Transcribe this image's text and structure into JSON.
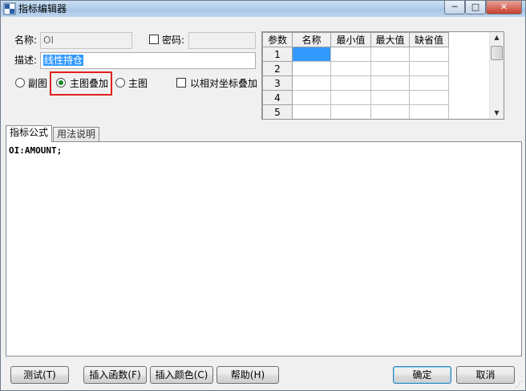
{
  "window": {
    "title": "指标编辑器",
    "controls": {
      "minimize": "─",
      "maximize": "□",
      "close": "✕"
    }
  },
  "form": {
    "name_label": "名称:",
    "name_value": "OI",
    "password_label": "密码:",
    "password_checked": false,
    "password_value": "",
    "desc_label": "描述:",
    "desc_value": "线性持仓",
    "radios": [
      {
        "label": "副图",
        "checked": false
      },
      {
        "label": "主图叠加",
        "checked": true
      },
      {
        "label": "主图",
        "checked": false
      }
    ],
    "relative_coord_label": "以相对坐标叠加",
    "relative_coord_checked": false
  },
  "params_grid": {
    "headers": [
      "参数",
      "名称",
      "最小值",
      "最大值",
      "缺省值"
    ],
    "rows": [
      "1",
      "2",
      "3",
      "4",
      "5"
    ]
  },
  "tabs": [
    {
      "label": "指标公式",
      "active": true
    },
    {
      "label": "用法说明",
      "active": false
    }
  ],
  "editor": {
    "code": "OI:AMOUNT;"
  },
  "buttons": {
    "test": "测试(T)",
    "insert_function": "插入函数(F)",
    "insert_color": "插入颜色(C)",
    "help": "帮助(H)",
    "ok": "确定",
    "cancel": "取消"
  }
}
